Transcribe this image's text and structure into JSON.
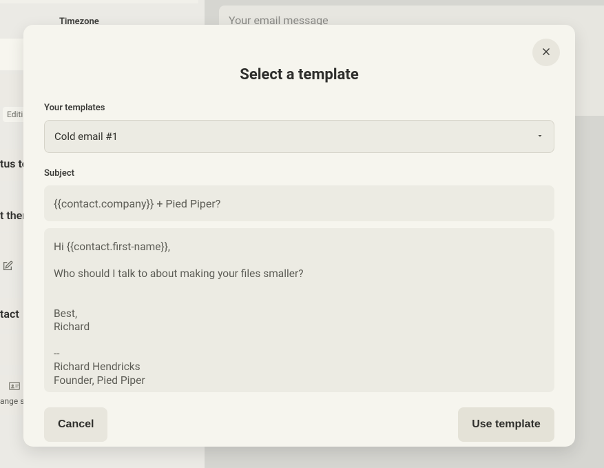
{
  "background": {
    "left": {
      "timezone_label": "Timezone",
      "editing_badge": "Editin",
      "cut1": "tus to",
      "cut2": "t then",
      "cut3": "tact",
      "cut4": "ange st"
    },
    "compose": {
      "placeholder": "Your email message"
    }
  },
  "modal": {
    "title": "Select a template",
    "labels": {
      "your_templates": "Your templates",
      "subject": "Subject"
    },
    "template_select": {
      "value": "Cold email #1"
    },
    "subject_value": "{{contact.company}} + Pied Piper?",
    "body": "Hi {{contact.first-name}},\n\nWho should I talk to about making your files smaller?\n\n\nBest,\nRichard\n\n--\nRichard Hendricks\nFounder, Pied Piper",
    "buttons": {
      "cancel": "Cancel",
      "use": "Use template"
    }
  }
}
